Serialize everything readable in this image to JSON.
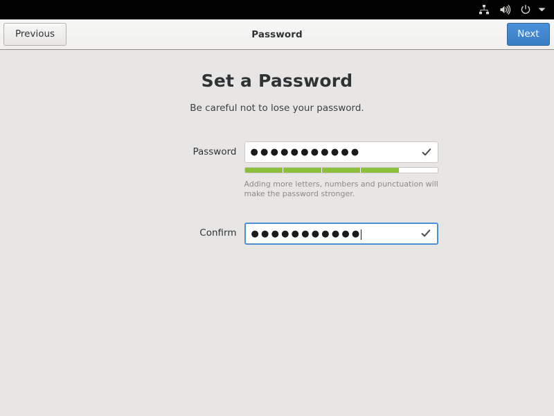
{
  "system_bar": {
    "icons": [
      {
        "name": "network-icon",
        "label": "Network"
      },
      {
        "name": "volume-icon",
        "label": "Volume"
      },
      {
        "name": "power-icon",
        "label": "Power"
      },
      {
        "name": "chevron-down-icon",
        "label": "Menu"
      }
    ]
  },
  "toolbar": {
    "previous_label": "Previous",
    "title": "Password",
    "next_label": "Next"
  },
  "page": {
    "title": "Set a Password",
    "subtitle": "Be careful not to lose your password."
  },
  "form": {
    "password": {
      "label": "Password",
      "value": "●●●●●●●●●●●",
      "char_count": 11,
      "valid": true,
      "check_icon": "check-icon"
    },
    "strength": {
      "segments_total": 5,
      "segments_filled": 4,
      "fill_color": "#8ac03c",
      "empty_color": "#ffffff",
      "hint": "Adding more letters, numbers and punctuation will make the password stronger."
    },
    "confirm": {
      "label": "Confirm",
      "value": "●●●●●●●●●●●",
      "char_count": 11,
      "focused": true,
      "valid": true,
      "check_icon": "check-icon"
    }
  },
  "colors": {
    "accent": "#4a90d9",
    "background": "#e7e6e4",
    "toolbar": "#f4f3f1",
    "system_bar": "#000000",
    "strength_green": "#8ac03c",
    "text": "#2e3436",
    "muted_text": "#8b8a87"
  }
}
